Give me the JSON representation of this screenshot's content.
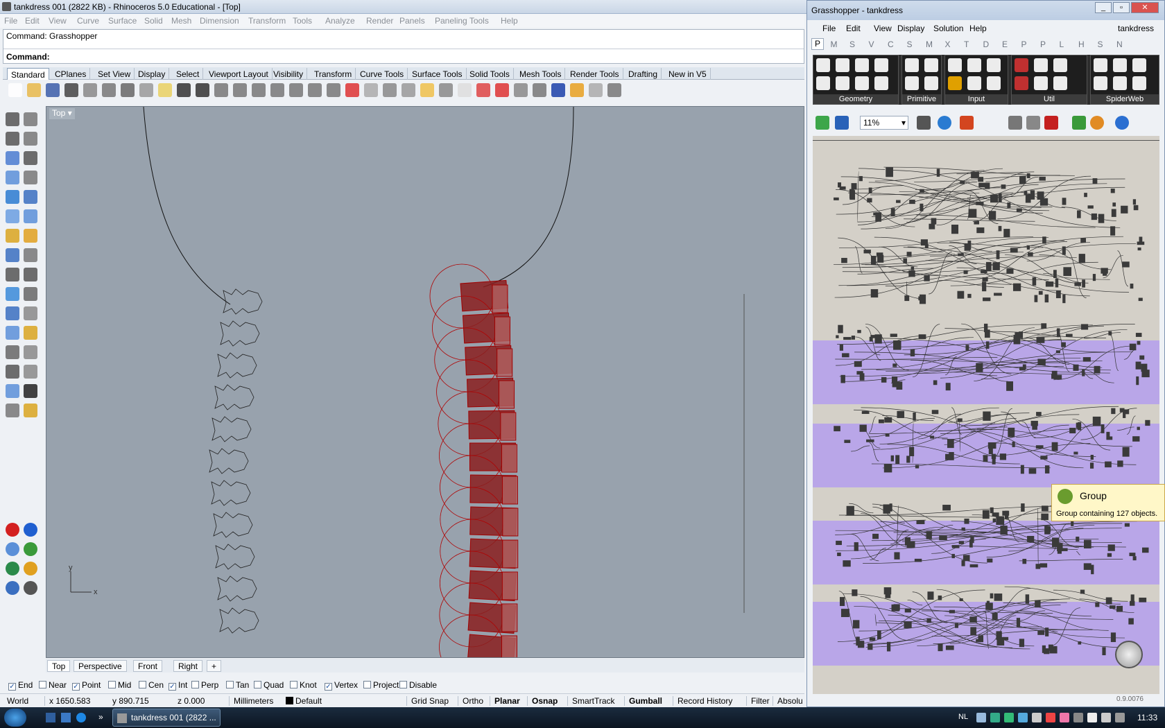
{
  "rhino": {
    "title": "tankdress 001 (2822 KB) - Rhinoceros 5.0 Educational - [Top]",
    "menu": [
      "File",
      "Edit",
      "View",
      "Curve",
      "Surface",
      "Solid",
      "Mesh",
      "Dimension",
      "Transform",
      "Tools",
      "Analyze",
      "Render",
      "Panels",
      "Paneling Tools",
      "Help"
    ],
    "command_history": "Command: Grasshopper",
    "command_prompt": "Command:",
    "toolbar_tabs": [
      "Standard",
      "CPlanes",
      "Set View",
      "Display",
      "Select",
      "Viewport Layout",
      "Visibility",
      "Transform",
      "Curve Tools",
      "Surface Tools",
      "Solid Tools",
      "Mesh Tools",
      "Render Tools",
      "Drafting",
      "New in V5"
    ],
    "viewport_label": "Top",
    "axis_x": "x",
    "axis_y": "y",
    "viewport_tabs": [
      "Top",
      "Perspective",
      "Front",
      "Right"
    ],
    "osnaps": [
      {
        "label": "End",
        "checked": true
      },
      {
        "label": "Near",
        "checked": false
      },
      {
        "label": "Point",
        "checked": true
      },
      {
        "label": "Mid",
        "checked": false
      },
      {
        "label": "Cen",
        "checked": false
      },
      {
        "label": "Int",
        "checked": true
      },
      {
        "label": "Perp",
        "checked": false
      },
      {
        "label": "Tan",
        "checked": false
      },
      {
        "label": "Quad",
        "checked": false
      },
      {
        "label": "Knot",
        "checked": false
      },
      {
        "label": "Vertex",
        "checked": true
      },
      {
        "label": "Project",
        "checked": false
      },
      {
        "label": "Disable",
        "checked": false
      }
    ],
    "status": {
      "cplane": "World",
      "x": "x 1650.583",
      "y": "y 890.715",
      "z": "z 0.000",
      "units": "Millimeters",
      "layer": "Default",
      "grid_snap": "Grid Snap",
      "ortho": "Ortho",
      "planar": "Planar",
      "osnap": "Osnap",
      "smarttrack": "SmartTrack",
      "gumball": "Gumball",
      "record_history": "Record History",
      "filter": "Filter",
      "absolute": "Absolu"
    }
  },
  "grasshopper": {
    "title": "Grasshopper - tankdress",
    "menu": [
      "File",
      "Edit",
      "View",
      "Display",
      "Solution",
      "Help"
    ],
    "document_name": "tankdress",
    "component_tabs": [
      "P",
      "M",
      "S",
      "V",
      "C",
      "S",
      "M",
      "X",
      "T",
      "D",
      "E",
      "P",
      "P",
      "L",
      "H",
      "S",
      "N"
    ],
    "ribbon_groups": [
      "Geometry",
      "Primitive",
      "Input",
      "Util",
      "SpiderWeb"
    ],
    "zoom": "11%",
    "tooltip_title": "Group",
    "tooltip_body": "Group containing 127 objects.",
    "version": "0.9.0076"
  },
  "taskbar": {
    "task_label": "tankdress 001 (2822 ...",
    "language": "NL",
    "clock": "11:33"
  },
  "colors": {
    "viewport_bg": "#98a2ad",
    "gh_group": "#b9a6e8",
    "gh_canvas": "#d4d0c8",
    "selection_red": "#b00000"
  }
}
